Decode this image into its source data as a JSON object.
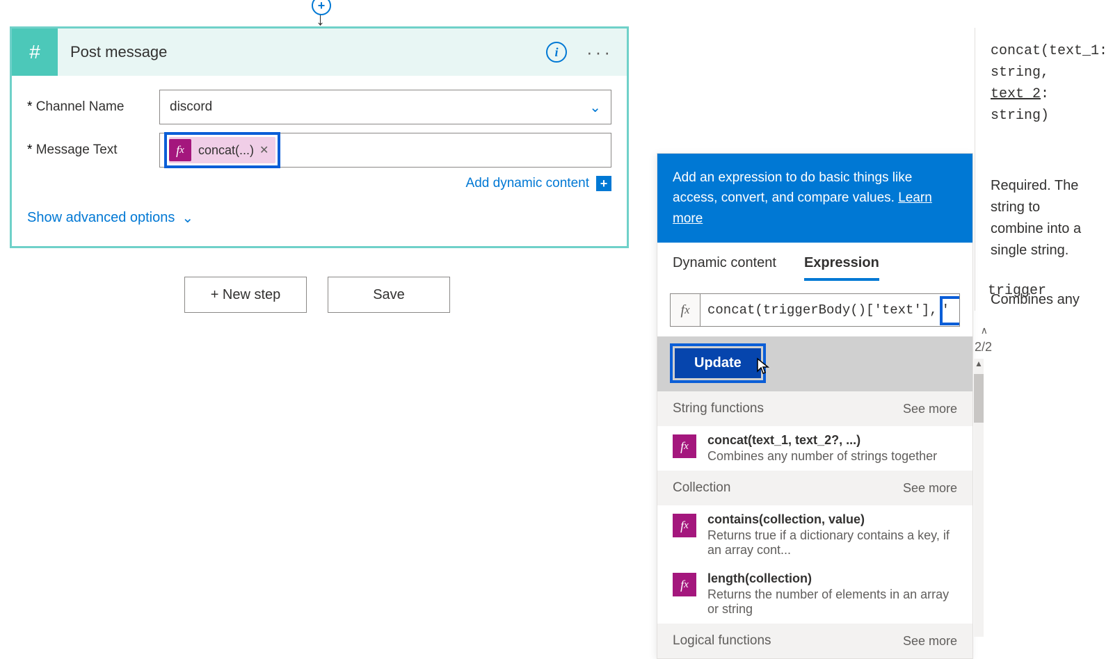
{
  "card": {
    "title": "Post message",
    "fields": {
      "channel_label": "Channel Name",
      "channel_value": "discord",
      "message_label": "Message Text",
      "token_label": "concat(...)"
    },
    "add_dynamic": "Add dynamic content",
    "advanced": "Show advanced options"
  },
  "footer": {
    "new_step": "+ New step",
    "save": "Save"
  },
  "expression_panel": {
    "banner1": "Add an expression to do basic things like access,",
    "banner2": "convert, and compare values.",
    "learn_more": "Learn more",
    "tabs": {
      "dynamic": "Dynamic content",
      "expression": "Expression"
    },
    "pager": "2/2",
    "expr_prefix": "concat(triggerBody()['text'],",
    "expr_mid": "' '",
    "expr_trail": "trigger",
    "update": "Update",
    "categories": [
      {
        "title": "String functions",
        "see_more": "See more",
        "items": [
          {
            "sig": "concat(text_1, text_2?, ...)",
            "desc": "Combines any number of strings together"
          }
        ]
      },
      {
        "title": "Collection",
        "see_more": "See more",
        "items": [
          {
            "sig": "contains(collection, value)",
            "desc": "Returns true if a dictionary contains a key, if an array cont..."
          },
          {
            "sig": "length(collection)",
            "desc": "Returns the number of elements in an array or string"
          }
        ]
      },
      {
        "title": "Logical functions",
        "see_more": "See more",
        "items": []
      }
    ]
  },
  "tooltip": {
    "l1": "concat(text_1:",
    "l2": "string,",
    "l3": "text_2",
    "l3b": ":",
    "l4": "string)",
    "body1": "Required.   The",
    "body2": "string          to",
    "body3": "combine into a",
    "body4": "single string.",
    "body5": "Combines  any"
  }
}
